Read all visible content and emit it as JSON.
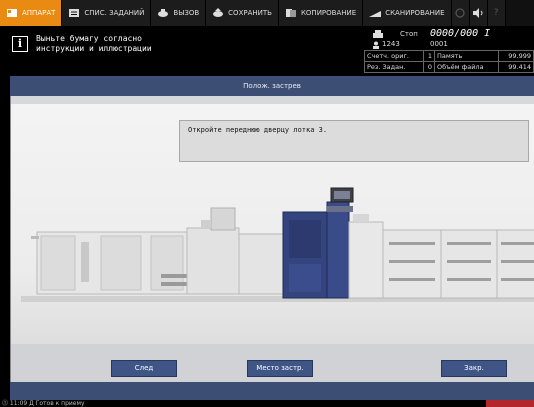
{
  "tabs": [
    {
      "label": "АППАРАТ",
      "icon": "machine-icon",
      "active": true
    },
    {
      "label": "СПИС. ЗАДАНИЙ",
      "icon": "job-list-icon",
      "active": false
    },
    {
      "label": "ВЫЗОВ",
      "icon": "recall-icon",
      "active": false
    },
    {
      "label": "СОХРАНИТЬ",
      "icon": "save-icon",
      "active": false
    },
    {
      "label": "КОПИРОВАНИЕ",
      "icon": "copy-icon",
      "active": false
    },
    {
      "label": "СКАНИРОВАНИЕ",
      "icon": "scan-icon",
      "active": false
    }
  ],
  "header": {
    "message_line1": "Выньте бумагу согласно",
    "message_line2": "инструкции и иллюстрации",
    "status": {
      "stop_label": "Стоп",
      "counter": "0000/000 I",
      "user_value": "1243",
      "user_value2": "0001"
    },
    "table": {
      "row1": {
        "label1": "Счетч. ориг.",
        "value1": "1",
        "label2": "Память",
        "value2": "99.999"
      },
      "row2": {
        "label1": "Рез. Задан.",
        "value1": "0",
        "label2": "Объём файла",
        "value2": "99.414"
      }
    }
  },
  "title": "Полож. застрев",
  "instruction": "Откройте переднюю дверцу лотка 3.",
  "buttons": {
    "next": "След",
    "jam_location": "Место застр.",
    "close": "Закр."
  },
  "statusbar": {
    "text": "⓵ 11:09  Д Готов к приему"
  },
  "colors": {
    "active_tab": "#e98a12",
    "accent_blue": "#3c4e74",
    "button_blue": "#3e5585",
    "warning_red": "#b3262b"
  }
}
